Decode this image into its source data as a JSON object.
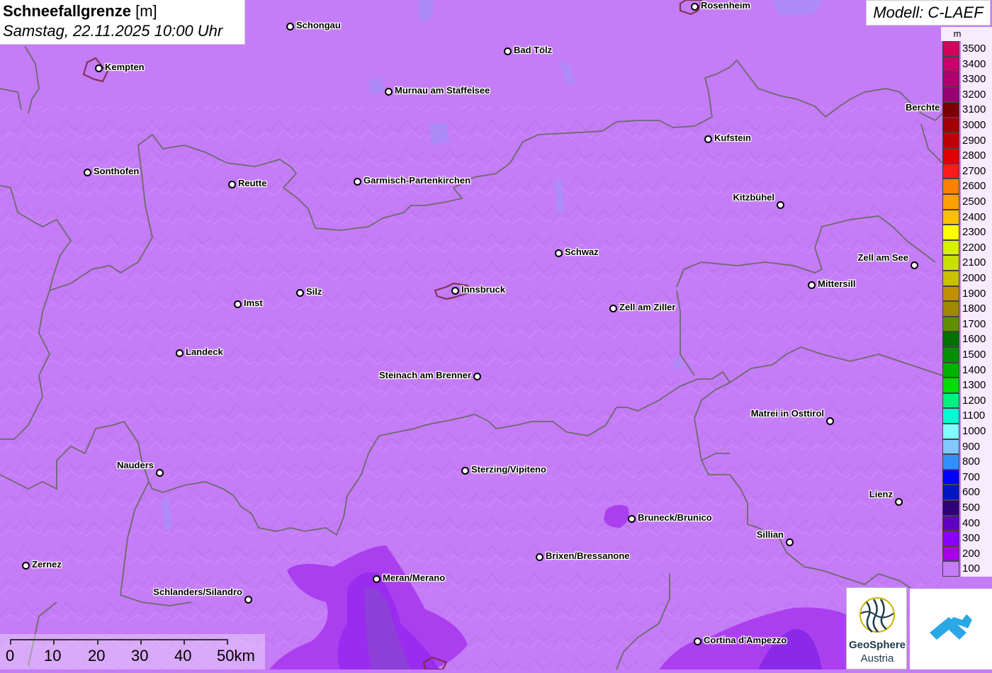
{
  "title": {
    "main": "Schneefallgrenze",
    "unit": "[m]",
    "date": "Samstag, 22.11.2025 10:00 Uhr"
  },
  "model": "Modell: C-LAEF",
  "legend": {
    "unit": "m",
    "items": [
      {
        "label": "3500",
        "color": "#d4005a"
      },
      {
        "label": "3400",
        "color": "#c8006a"
      },
      {
        "label": "3300",
        "color": "#b0006e"
      },
      {
        "label": "3200",
        "color": "#980072"
      },
      {
        "label": "3100",
        "color": "#7a0000"
      },
      {
        "label": "3000",
        "color": "#a00000"
      },
      {
        "label": "2900",
        "color": "#c00000"
      },
      {
        "label": "2800",
        "color": "#e00000"
      },
      {
        "label": "2700",
        "color": "#ff1a1a"
      },
      {
        "label": "2600",
        "color": "#ff8000"
      },
      {
        "label": "2500",
        "color": "#ffa000"
      },
      {
        "label": "2400",
        "color": "#ffc000"
      },
      {
        "label": "2300",
        "color": "#ffff00"
      },
      {
        "label": "2200",
        "color": "#d8f000"
      },
      {
        "label": "2100",
        "color": "#c8e000"
      },
      {
        "label": "2000",
        "color": "#c8c000"
      },
      {
        "label": "1900",
        "color": "#c09000"
      },
      {
        "label": "1800",
        "color": "#a08800"
      },
      {
        "label": "1700",
        "color": "#609000"
      },
      {
        "label": "1600",
        "color": "#007000"
      },
      {
        "label": "1500",
        "color": "#009000"
      },
      {
        "label": "1400",
        "color": "#00b000"
      },
      {
        "label": "1300",
        "color": "#00dd00"
      },
      {
        "label": "1200",
        "color": "#00f080"
      },
      {
        "label": "1100",
        "color": "#00ffd0"
      },
      {
        "label": "1000",
        "color": "#80ffff"
      },
      {
        "label": "900",
        "color": "#80c8ff"
      },
      {
        "label": "800",
        "color": "#3090ff"
      },
      {
        "label": "700",
        "color": "#0000ff"
      },
      {
        "label": "600",
        "color": "#0018c0"
      },
      {
        "label": "500",
        "color": "#300078"
      },
      {
        "label": "400",
        "color": "#6000c0"
      },
      {
        "label": "300",
        "color": "#8800ff"
      },
      {
        "label": "200",
        "color": "#a800e8"
      },
      {
        "label": "100",
        "color": "#c57cf7"
      }
    ]
  },
  "cities": [
    {
      "name": "Rosenheim",
      "label_side": "right"
    },
    {
      "name": "Schongau",
      "label_side": "right"
    },
    {
      "name": "Bad Tölz",
      "label_side": "right"
    },
    {
      "name": "Kempten",
      "label_side": "right"
    },
    {
      "name": "Murnau am Staffelsee",
      "label_side": "right"
    },
    {
      "name": "Berchte",
      "label_side": "right"
    },
    {
      "name": "Kufstein",
      "label_side": "right"
    },
    {
      "name": "Sonthofen",
      "label_side": "right"
    },
    {
      "name": "Reutte",
      "label_side": "right"
    },
    {
      "name": "Garmisch-Partenkirchen",
      "label_side": "right"
    },
    {
      "name": "Kitzbühel",
      "label_side": "left"
    },
    {
      "name": "Schwaz",
      "label_side": "right"
    },
    {
      "name": "Zell am See",
      "label_side": "left"
    },
    {
      "name": "Mittersill",
      "label_side": "right"
    },
    {
      "name": "Innsbruck",
      "label_side": "right"
    },
    {
      "name": "Silz",
      "label_side": "right"
    },
    {
      "name": "Imst",
      "label_side": "right"
    },
    {
      "name": "Zell am Ziller",
      "label_side": "right"
    },
    {
      "name": "Landeck",
      "label_side": "right"
    },
    {
      "name": "Steinach am Brenner",
      "label_side": "left"
    },
    {
      "name": "Matrei in Osttirol",
      "label_side": "left"
    },
    {
      "name": "Nauders",
      "label_side": "left"
    },
    {
      "name": "Sterzing/Vipiteno",
      "label_side": "right"
    },
    {
      "name": "Bruneck/Brunico",
      "label_side": "right"
    },
    {
      "name": "Lienz",
      "label_side": "left"
    },
    {
      "name": "Sillian",
      "label_side": "left"
    },
    {
      "name": "Brixen/Bressanone",
      "label_side": "right"
    },
    {
      "name": "Zernez",
      "label_side": "right"
    },
    {
      "name": "Meran/Merano",
      "label_side": "right"
    },
    {
      "name": "Schlanders/Silandro",
      "label_side": "left"
    },
    {
      "name": "Cortina d'Ampezzo",
      "label_side": "right"
    }
  ],
  "scale": {
    "labels": [
      "0",
      "10",
      "20",
      "30",
      "40",
      "50km"
    ]
  },
  "logo": {
    "line1": "GeoSphere",
    "line2": "Austria"
  }
}
